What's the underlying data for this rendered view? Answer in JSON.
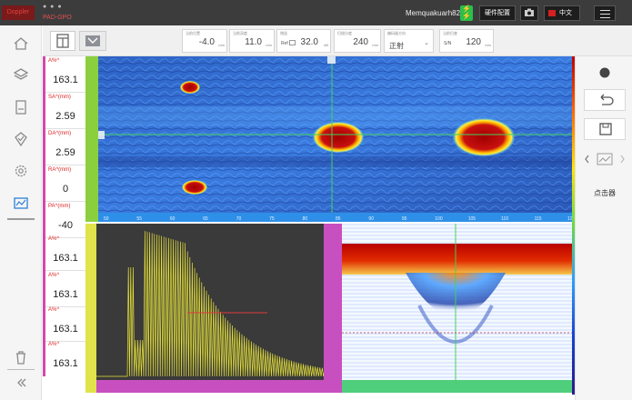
{
  "titlebar": {
    "logo": "Doppler",
    "app_name": "PAD-GPO",
    "device_id": "Memquakuarh82",
    "hw_config_label": "硬件配置",
    "lang_label": "中文"
  },
  "toolbar": {
    "params": [
      {
        "label": "当前位置",
        "value": "-4.0",
        "unit": "mm"
      },
      {
        "label": "当前深度",
        "value": "11.0",
        "unit": "mm"
      },
      {
        "label": "增益",
        "value": "32.0",
        "unit": "dB",
        "prefix": "Ref"
      },
      {
        "label": "扫描分度",
        "value": "240",
        "unit": "mm"
      },
      {
        "label": "编码器方向",
        "value": "正射",
        "dropdown": true
      },
      {
        "label": "当前扫查",
        "value": "120",
        "unit": "mm",
        "prefix": "S/N"
      }
    ]
  },
  "readings": [
    {
      "label": "A%^",
      "value": "163.1"
    },
    {
      "label": "SA^(mm)",
      "value": "2.59"
    },
    {
      "label": "DA^(mm)",
      "value": "2.59"
    },
    {
      "label": "RA^(mm)",
      "value": "0"
    },
    {
      "label": "PA^(mm)",
      "value": "-40"
    },
    {
      "label": "A%^",
      "value": "163.1"
    },
    {
      "label": "A%^",
      "value": "163.1"
    },
    {
      "label": "A%^",
      "value": "163.1"
    },
    {
      "label": "A%^",
      "value": "163.1"
    }
  ],
  "rightpanel": {
    "clicker_label": "点击器"
  },
  "cscan_axis_ticks": [
    "50",
    "55",
    "60",
    "65",
    "70",
    "75",
    "80",
    "85",
    "90",
    "95",
    "100",
    "105",
    "110",
    "115",
    "120"
  ],
  "colors": {
    "titlebar": "#3c3c3c",
    "accent_blue": "#2b7fd8",
    "gate_magenta": "#d24aa8",
    "cursor_green": "#43d05c",
    "indication_red": "#b00000"
  }
}
